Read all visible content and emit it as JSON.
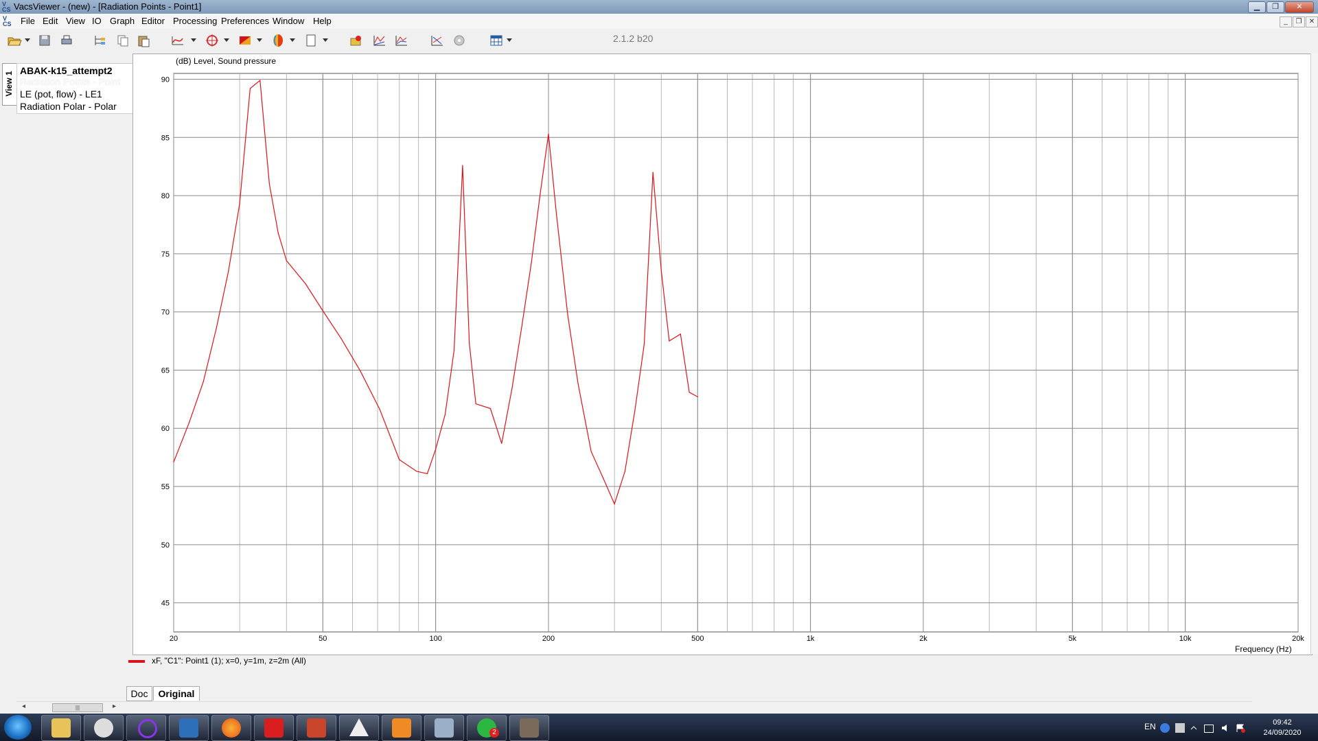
{
  "window": {
    "title": "VacsViewer - (new) - [Radiation Points - Point1]",
    "app_icon_text": "V\nCS",
    "buttons": {
      "minimize": "▁",
      "maximize": "❐",
      "close": "✕"
    }
  },
  "menu": {
    "items": [
      "File",
      "Edit",
      "View",
      "IO",
      "Graph",
      "Editor",
      "Processing",
      "Preferences",
      "Window",
      "Help"
    ],
    "mdi_buttons": {
      "minimize": "_",
      "restore": "❐",
      "close": "✕"
    }
  },
  "toolbar": {
    "version": "2.1.2 b20",
    "icons": [
      "open-folder-icon",
      "save-icon",
      "print-icon",
      "tree-icon",
      "copy-icon",
      "paste-icon",
      "curve-icon",
      "target-icon",
      "color-fill-icon",
      "palette-icon",
      "page-icon",
      "export-icon",
      "fft-graph-icon",
      "multi-graph-icon",
      "xy-graph-icon",
      "settings-disc-icon",
      "window-layout-icon"
    ]
  },
  "side_panel": {
    "tab_label": "View 1",
    "lines": [
      "ABAK-k15_attempt2",
      "Radiation Points - Point",
      "LE (pot, flow) - LE1",
      "Radiation Polar - Polar"
    ]
  },
  "graph": {
    "ylabel": "(dB)  Level, Sound pressure",
    "xlabel": "Frequency  (Hz)",
    "legend": "xF, \"C1\": Point1 (1); x=0, y=1m, z=2m  (All)",
    "line_color": "#d9141c"
  },
  "chart_data": {
    "type": "line",
    "xscale": "log",
    "xlim": [
      20,
      20000
    ],
    "ylim": [
      42.5,
      90.5
    ],
    "xticks": [
      20,
      50,
      100,
      200,
      500,
      1000,
      2000,
      5000,
      10000,
      20000
    ],
    "xtick_labels": [
      "20",
      "50",
      "100",
      "200",
      "500",
      "1k",
      "2k",
      "5k",
      "10k",
      "20k"
    ],
    "yticks": [
      45,
      50,
      55,
      60,
      65,
      70,
      75,
      80,
      85,
      90
    ],
    "grid": true,
    "series": [
      {
        "x": [
          20,
          22,
          24,
          26,
          28,
          30,
          32,
          34,
          36,
          38,
          40,
          45,
          50,
          56,
          63,
          71,
          80,
          89,
          95,
          100,
          106,
          112,
          118,
          123,
          128,
          140,
          150,
          160,
          170,
          180,
          190,
          200,
          210,
          225,
          240,
          260,
          280,
          300,
          320,
          340,
          360,
          380,
          400,
          420,
          450,
          475,
          500
        ],
        "y": [
          57.1,
          60.5,
          64.0,
          68.6,
          73.5,
          79.3,
          89.2,
          89.9,
          81.0,
          76.8,
          74.4,
          72.4,
          70.1,
          67.7,
          64.9,
          61.6,
          57.3,
          56.3,
          56.1,
          58.2,
          61.2,
          66.7,
          82.6,
          67.3,
          62.1,
          61.7,
          58.7,
          63.5,
          68.9,
          74.2,
          80.1,
          85.3,
          78.4,
          69.8,
          63.8,
          58.0,
          55.7,
          53.5,
          56.3,
          61.5,
          67.2,
          82.0,
          73.5,
          67.5,
          68.1,
          63.1,
          62.7
        ]
      }
    ]
  },
  "bottom_tabs": [
    "Doc",
    "Original"
  ],
  "taskbar": {
    "language": "EN",
    "time": "09:42",
    "date": "24/09/2020",
    "apps": [
      "file-explorer-icon",
      "alien-app-icon",
      "cortana-ring-icon",
      "excel-icon",
      "firefox-icon",
      "pdf-icon",
      "archive-icon",
      "terminal-triangle-icon",
      "fusion-app-icon",
      "vacs-icon",
      "whatsapp-icon",
      "gimp-icon"
    ],
    "whatsapp_badge": "2"
  }
}
